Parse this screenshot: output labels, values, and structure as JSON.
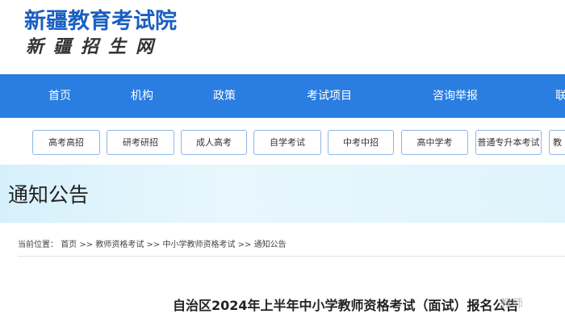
{
  "header": {
    "site_title": "新疆教育考试院",
    "site_subtitle": "新疆招生网"
  },
  "nav": {
    "items": [
      {
        "label": "首页"
      },
      {
        "label": "机构"
      },
      {
        "label": "政策"
      },
      {
        "label": "考试项目"
      },
      {
        "label": "咨询举报"
      },
      {
        "label": "联"
      }
    ]
  },
  "subnav": {
    "items": [
      {
        "label": "高考高招"
      },
      {
        "label": "研考研招"
      },
      {
        "label": "成人高考"
      },
      {
        "label": "自学考试"
      },
      {
        "label": "中考中招"
      },
      {
        "label": "高中学考"
      },
      {
        "label": "普通专升本考试"
      },
      {
        "label": "教"
      }
    ]
  },
  "banner": {
    "title": "通知公告"
  },
  "breadcrumb": {
    "prefix": "当前位置：",
    "items": [
      {
        "label": "首页"
      },
      {
        "label": "教师资格考试"
      },
      {
        "label": "中小学教师资格考试"
      },
      {
        "label": "通知公告"
      }
    ],
    "separator": ">>"
  },
  "article": {
    "title": "自治区2024年上半年中小学教师资格考试（面试）报名公告"
  },
  "watermark": {
    "text": "教师"
  },
  "colors": {
    "nav_bg": "#2a7de1",
    "brand_title": "#1a5fc0",
    "subnav_border": "#8fb6e6",
    "banner_bg": "#d6f0fb"
  }
}
